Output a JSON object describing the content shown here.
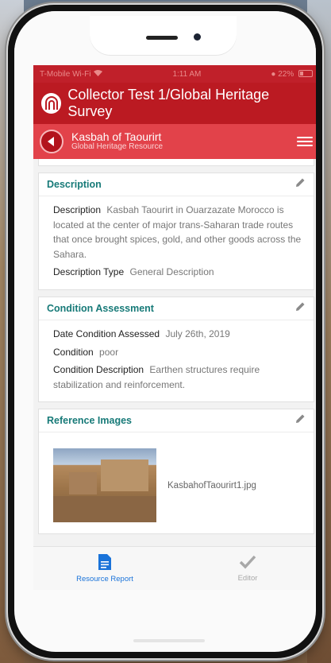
{
  "status_bar": {
    "carrier": "T-Mobile Wi-Fi",
    "time": "1:11 AM",
    "battery": "22%"
  },
  "app": {
    "title": "Collector Test 1/Global Heritage Survey"
  },
  "record": {
    "title": "Kasbah of Taourirt",
    "subtitle": "Global Heritage Resource"
  },
  "sections": {
    "description": {
      "title": "Description",
      "desc_label": "Description",
      "desc_value": "Kasbah Taourirt in Ouarzazate Morocco is located at the center of major trans-Saharan trade routes that once brought spices, gold, and other goods across the Sahara.",
      "type_label": "Description Type",
      "type_value": "General Description"
    },
    "condition": {
      "title": "Condition Assessment",
      "date_label": "Date Condition Assessed",
      "date_value": "July 26th, 2019",
      "cond_label": "Condition",
      "cond_value": "poor",
      "cdesc_label": "Condition Description",
      "cdesc_value": "Earthen structures require stabilization and reinforcement."
    },
    "images": {
      "title": "Reference Images",
      "file_name": "KasbahofTaourirt1.jpg"
    }
  },
  "tabs": [
    {
      "label": "Resource Report",
      "icon": "document-icon",
      "active": true
    },
    {
      "label": "Editor",
      "icon": "checkmark-icon",
      "active": false
    }
  ],
  "colors": {
    "status_bar": "#c0202a",
    "app_bar": "#bb1a22",
    "record_bar": "#e2424a",
    "section_title": "#177a78",
    "active_tab": "#1a73d9"
  }
}
